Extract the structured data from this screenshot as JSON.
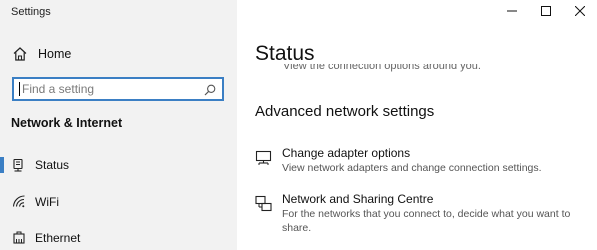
{
  "window": {
    "title": "Settings",
    "controls": [
      "minimize-icon",
      "maximize-icon",
      "close-icon"
    ]
  },
  "sidebar": {
    "home_label": "Home",
    "home_icon": "home-icon",
    "search_placeholder": "Find a setting",
    "search_icon": "search-icon",
    "section_title": "Network & Internet",
    "items": [
      {
        "label": "Status",
        "icon": "status-globe-icon",
        "selected": true
      },
      {
        "label": "WiFi",
        "icon": "wifi-icon",
        "selected": false
      },
      {
        "label": "Ethernet",
        "icon": "ethernet-icon",
        "selected": false
      }
    ]
  },
  "main": {
    "page_title": "Status",
    "clipped_text": "View the connection options around you.",
    "advanced_title": "Advanced network settings",
    "options": [
      {
        "title": "Change adapter options",
        "desc": "View network adapters and change connection settings.",
        "icon": "network-adapter-icon"
      },
      {
        "title": "Network and Sharing Centre",
        "desc": "For the networks that you connect to, decide what you want to share.",
        "icon": "sharing-centre-icon"
      }
    ]
  },
  "colors": {
    "accent": "#3b7fc4",
    "sidebar_bg": "#f2f2f2",
    "main_bg": "#ffffff"
  }
}
